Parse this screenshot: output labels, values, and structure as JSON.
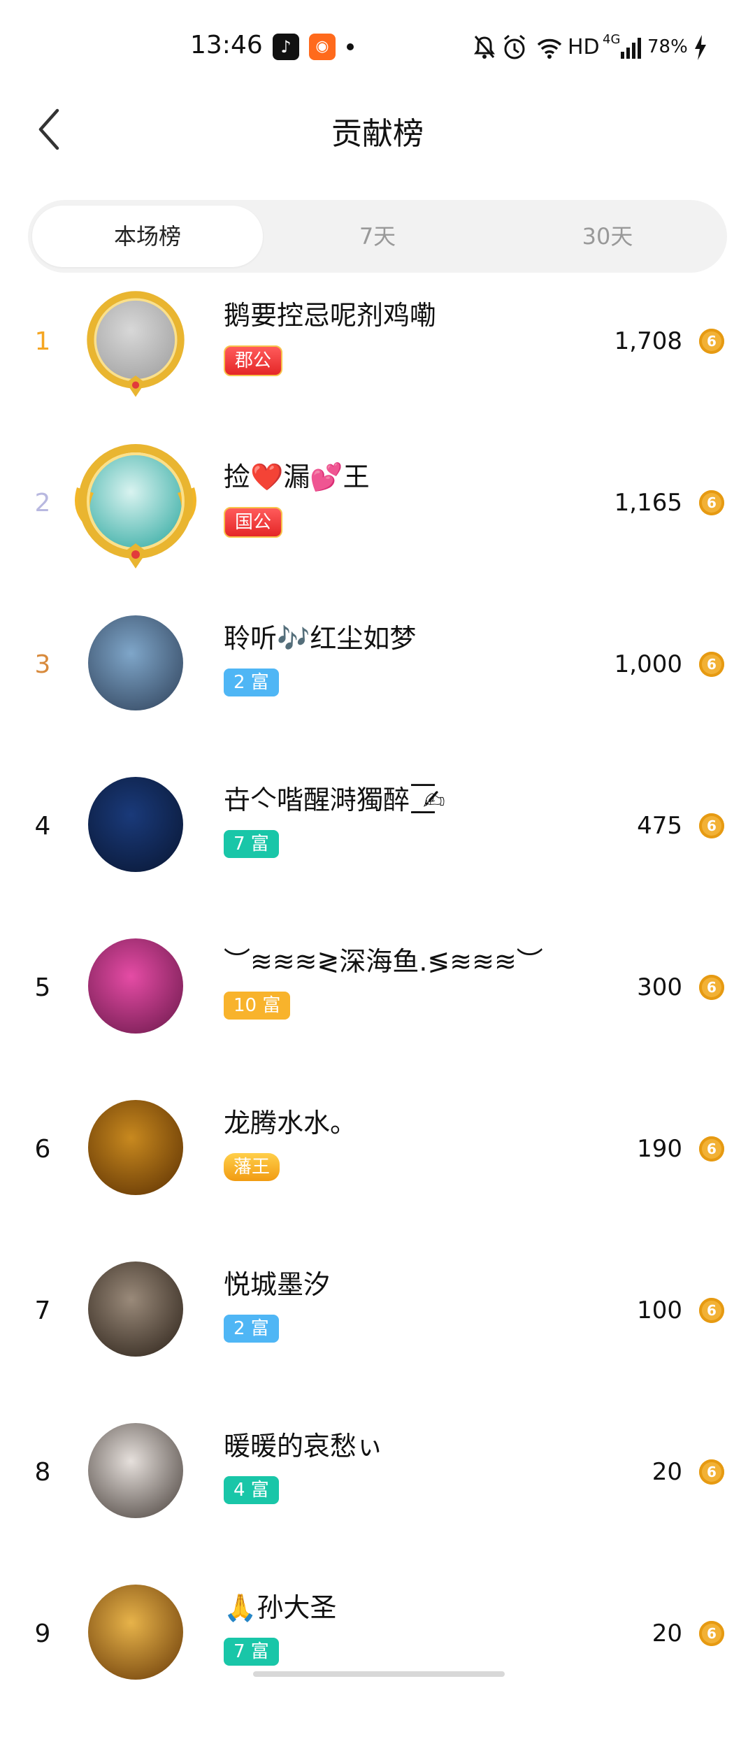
{
  "status_bar": {
    "time": "13:46",
    "network": "HD",
    "signal": "4G",
    "battery": "78%"
  },
  "header": {
    "title": "贡献榜",
    "back_icon": "back-arrow-icon"
  },
  "tabs": [
    {
      "label": "本场榜",
      "active": true
    },
    {
      "label": "7天",
      "active": false
    },
    {
      "label": "30天",
      "active": false
    }
  ],
  "colors": {
    "rank1": "#f5a623",
    "rank2": "#b8b8e0",
    "rank3": "#d88a3c",
    "coin": "#f2b135"
  },
  "leaderboard": [
    {
      "rank": "1",
      "name": "鹅要控忌呢剂鸡嘞",
      "badge": "郡公",
      "badge_style": "red",
      "score": "1,708",
      "coin_glyph": "6"
    },
    {
      "rank": "2",
      "name": "捡❤️漏💕王",
      "badge": "国公",
      "badge_style": "red",
      "score": "1,165",
      "coin_glyph": "6"
    },
    {
      "rank": "3",
      "name": "聆听🎶红尘如梦",
      "badge": "2 富",
      "badge_style": "blue",
      "score": "1,000",
      "coin_glyph": "6"
    },
    {
      "rank": "4",
      "name": "卋亽喈醒溡獨醉ˍ͟͟͞͞✍",
      "badge": "7 富",
      "badge_style": "teal",
      "score": "475",
      "coin_glyph": "6"
    },
    {
      "rank": "5",
      "name": "︶≋≋≋≷深海鱼.≶≋≋≋︶",
      "badge": "10 富",
      "badge_style": "orange",
      "score": "300",
      "coin_glyph": "6"
    },
    {
      "rank": "6",
      "name": "龙腾水水。",
      "badge": "藩王",
      "badge_style": "gold",
      "score": "190",
      "coin_glyph": "6"
    },
    {
      "rank": "7",
      "name": "悦城墨汐",
      "badge": "2 富",
      "badge_style": "blue",
      "score": "100",
      "coin_glyph": "6"
    },
    {
      "rank": "8",
      "name": "暖暖的哀愁ぃ",
      "badge": "4 富",
      "badge_style": "teal",
      "score": "20",
      "coin_glyph": "6"
    },
    {
      "rank": "9",
      "name": "🙏孙大圣",
      "badge": "7 富",
      "badge_style": "teal",
      "score": "20",
      "coin_glyph": "6"
    }
  ]
}
